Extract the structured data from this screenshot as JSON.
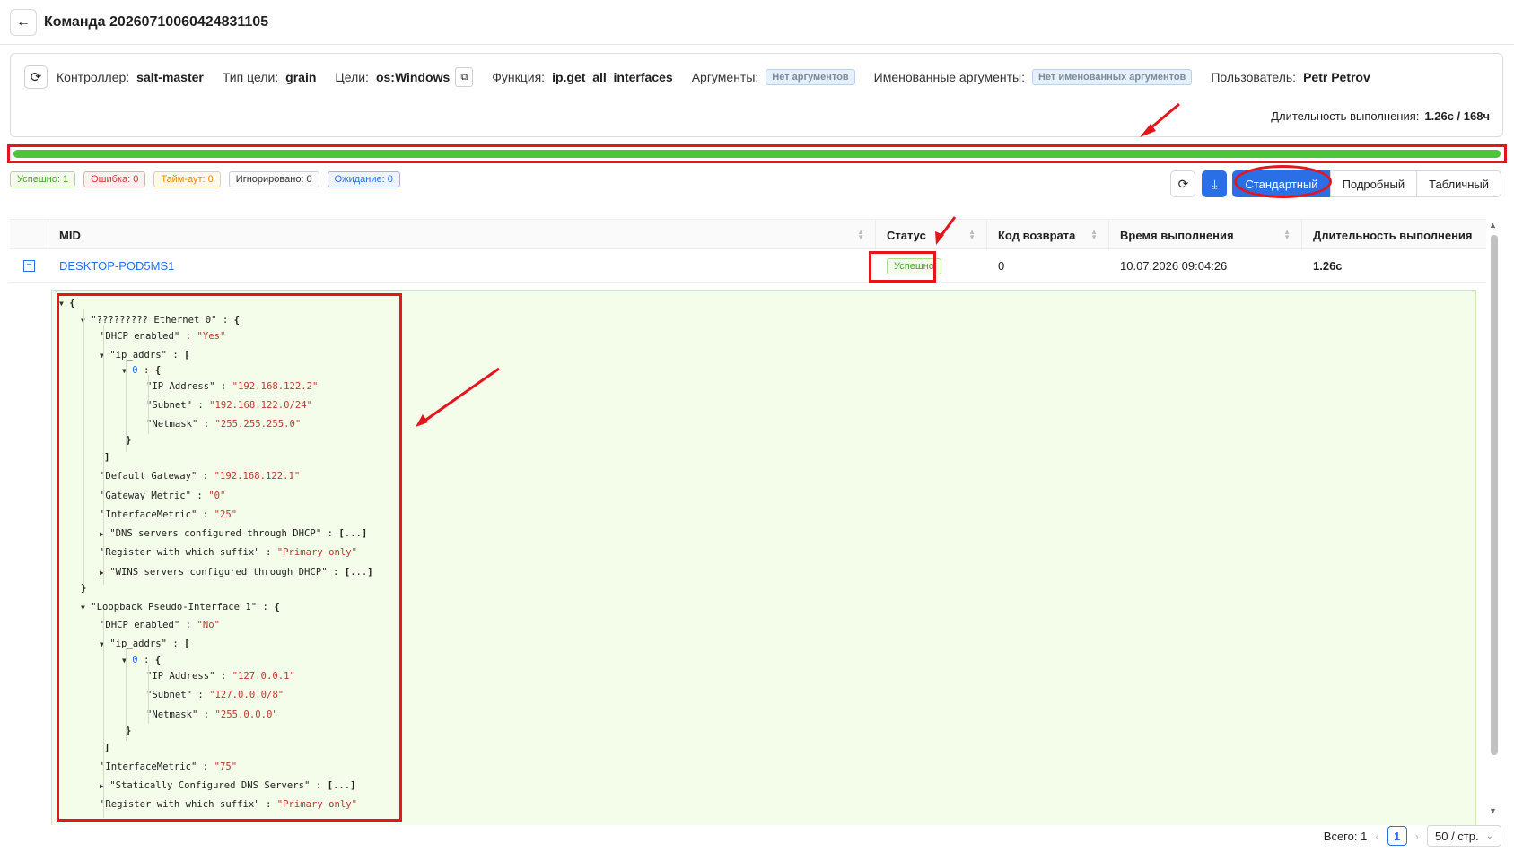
{
  "header": {
    "title": "Команда 20260710060424831105"
  },
  "info": {
    "controller_label": "Контроллер:",
    "controller": "salt-master",
    "target_type_label": "Тип цели:",
    "target_type": "grain",
    "targets_label": "Цели:",
    "targets": "os:Windows",
    "function_label": "Функция:",
    "function": "ip.get_all_interfaces",
    "args_label": "Аргументы:",
    "args": "Нет аргументов",
    "kwargs_label": "Именованные аргументы:",
    "kwargs": "Нет именованных аргументов",
    "user_label": "Пользователь:",
    "user": "Petr Petrov",
    "duration_label": "Длительность выполнения:",
    "duration": "1.26с / 168ч"
  },
  "progress": {
    "percent": 100,
    "color": "#4ec43a"
  },
  "counters": {
    "success": "Успешно: 1",
    "error": "Ошибка: 0",
    "timeout": "Тайм-аут: 0",
    "ignored": "Игнорировано: 0",
    "waiting": "Ожидание: 0"
  },
  "view_modes": {
    "standard": "Стандартный",
    "detailed": "Подробный",
    "table": "Табличный"
  },
  "table": {
    "headers": {
      "mid": "MID",
      "status": "Статус",
      "retcode": "Код возврата",
      "time": "Время выполнения",
      "duration": "Длительность выполнения"
    },
    "row": {
      "mid": "DESKTOP-POD5MS1",
      "status": "Успешно",
      "retcode": "0",
      "time": "10.07.2026 09:04:26",
      "duration": "1.26с"
    }
  },
  "json_lines": [
    {
      "t": "{"
    },
    {
      "t": "\"????????? Ethernet 0\" : {"
    },
    {
      "t": "\"DHCP enabled\" : \"Yes\""
    },
    {
      "t": "\"ip_addrs\" : ["
    },
    {
      "t": "0 : {"
    },
    {
      "t": "\"IP Address\" : \"192.168.122.2\""
    },
    {
      "t": "\"Subnet\" : \"192.168.122.0/24\""
    },
    {
      "t": "\"Netmask\" : \"255.255.255.0\""
    },
    {
      "t": "}"
    },
    {
      "t": "]"
    },
    {
      "t": "\"Default Gateway\" : \"192.168.122.1\""
    },
    {
      "t": "\"Gateway Metric\" : \"0\""
    },
    {
      "t": "\"InterfaceMetric\" : \"25\""
    },
    {
      "t": "\"DNS servers configured through DHCP\" : [...]"
    },
    {
      "t": "\"Register with which suffix\" : \"Primary only\""
    },
    {
      "t": "\"WINS servers configured through DHCP\" : [...]"
    },
    {
      "t": "}"
    },
    {
      "t": "\"Loopback Pseudo-Interface 1\" : {"
    },
    {
      "t": "\"DHCP enabled\" : \"No\""
    },
    {
      "t": "\"ip_addrs\" : ["
    },
    {
      "t": "0 : {"
    },
    {
      "t": "\"IP Address\" : \"127.0.0.1\""
    },
    {
      "t": "\"Subnet\" : \"127.0.0.0/8\""
    },
    {
      "t": "\"Netmask\" : \"255.0.0.0\""
    },
    {
      "t": "}"
    },
    {
      "t": "]"
    },
    {
      "t": "\"InterfaceMetric\" : \"75\""
    },
    {
      "t": "\"Statically Configured DNS Servers\" : [...]"
    },
    {
      "t": "\"Register with which suffix\" : \"Primary only\""
    }
  ],
  "footer": {
    "total": "Всего: 1",
    "page": "1",
    "per_page": "50 / стр."
  },
  "colors": {
    "accent": "#2b6fe6",
    "success": "#4ec43a",
    "annotation": "#e4161b"
  }
}
